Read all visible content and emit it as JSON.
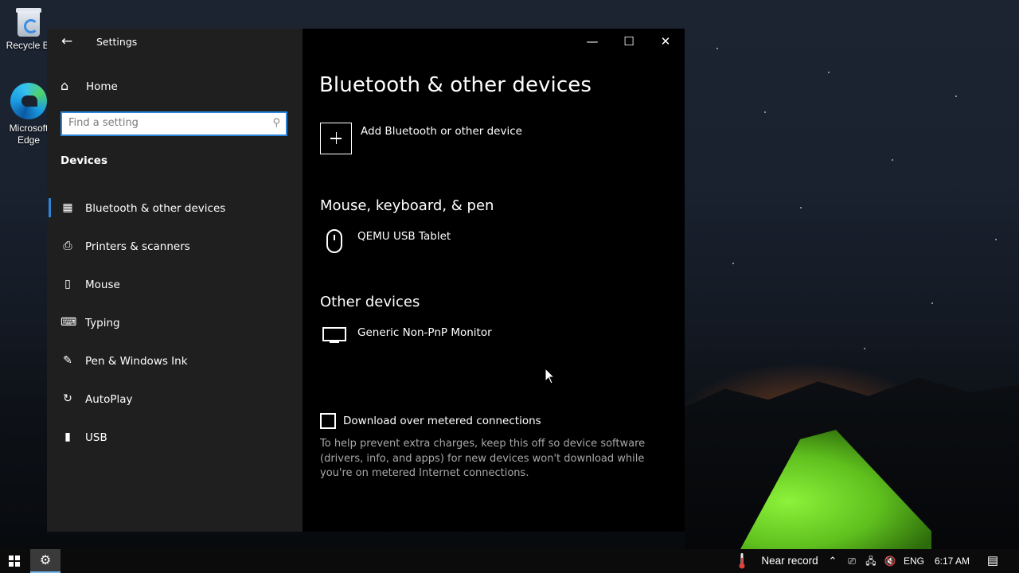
{
  "desktop": {
    "recycle_bin_label": "Recycle Bi",
    "edge_label_1": "Microsoft",
    "edge_label_2": "Edge"
  },
  "window": {
    "app_title": "Settings",
    "back_glyph": "←",
    "minimize_glyph": "—",
    "maximize_glyph": "☐",
    "close_glyph": "✕"
  },
  "sidebar": {
    "home_label": "Home",
    "search_placeholder": "Find a setting",
    "section_title": "Devices",
    "items": [
      {
        "label": "Bluetooth & other devices",
        "icon": "bluetooth-devices-icon",
        "selected": true
      },
      {
        "label": "Printers & scanners",
        "icon": "printer-icon"
      },
      {
        "label": "Mouse",
        "icon": "mouse-icon"
      },
      {
        "label": "Typing",
        "icon": "keyboard-icon"
      },
      {
        "label": "Pen & Windows Ink",
        "icon": "pen-icon"
      },
      {
        "label": "AutoPlay",
        "icon": "autoplay-icon"
      },
      {
        "label": "USB",
        "icon": "usb-icon"
      }
    ]
  },
  "main": {
    "title": "Bluetooth & other devices",
    "add_device_label": "Add Bluetooth or other device",
    "groups": [
      {
        "title": "Mouse, keyboard, & pen",
        "devices": [
          {
            "name": "QEMU USB Tablet",
            "icon": "mouse-device-icon"
          }
        ]
      },
      {
        "title": "Other devices",
        "devices": [
          {
            "name": "Generic Non-PnP Monitor",
            "icon": "monitor-icon"
          }
        ]
      }
    ],
    "metered_checkbox_label": "Download over metered connections",
    "metered_checked": false,
    "help_text": "To help prevent extra charges, keep this off so device software (drivers, info, and apps) for new devices won't download while you're on metered Internet connections."
  },
  "taskbar": {
    "weather_text": "Near record",
    "language": "ENG",
    "time": "6:17 AM"
  },
  "colors": {
    "accent": "#2b86db",
    "sidebar_bg": "#1f1f1f",
    "content_bg": "#000000"
  }
}
